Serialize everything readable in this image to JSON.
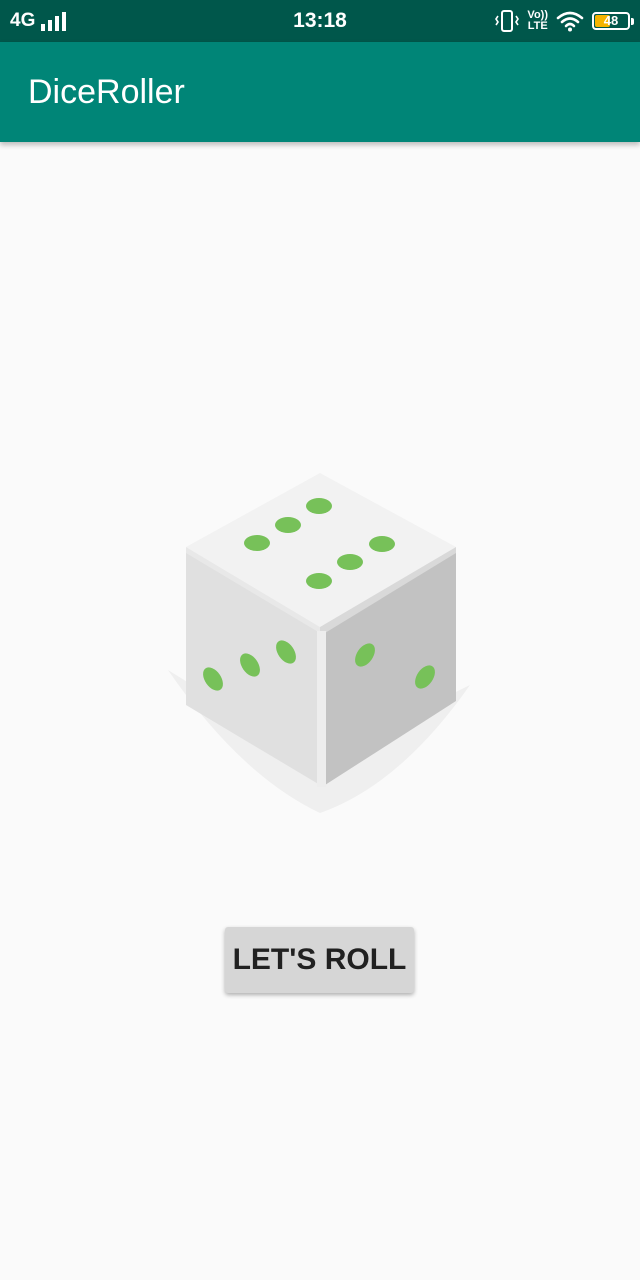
{
  "status_bar": {
    "network": "4G",
    "time": "13:18",
    "volte_top": "Vo))",
    "volte_bottom": "LTE",
    "battery": "48",
    "battery_level": 0.48
  },
  "app_bar": {
    "title": "DiceRoller"
  },
  "dice": {
    "top_face_value": 6,
    "left_face_value": 3,
    "right_face_value": 2,
    "pip_color": "#77c159"
  },
  "roll_button": {
    "label": "LET'S ROLL"
  },
  "colors": {
    "status_bar": "#00574b",
    "app_bar": "#008577",
    "background": "#fafafa",
    "button": "#d6d6d6"
  }
}
